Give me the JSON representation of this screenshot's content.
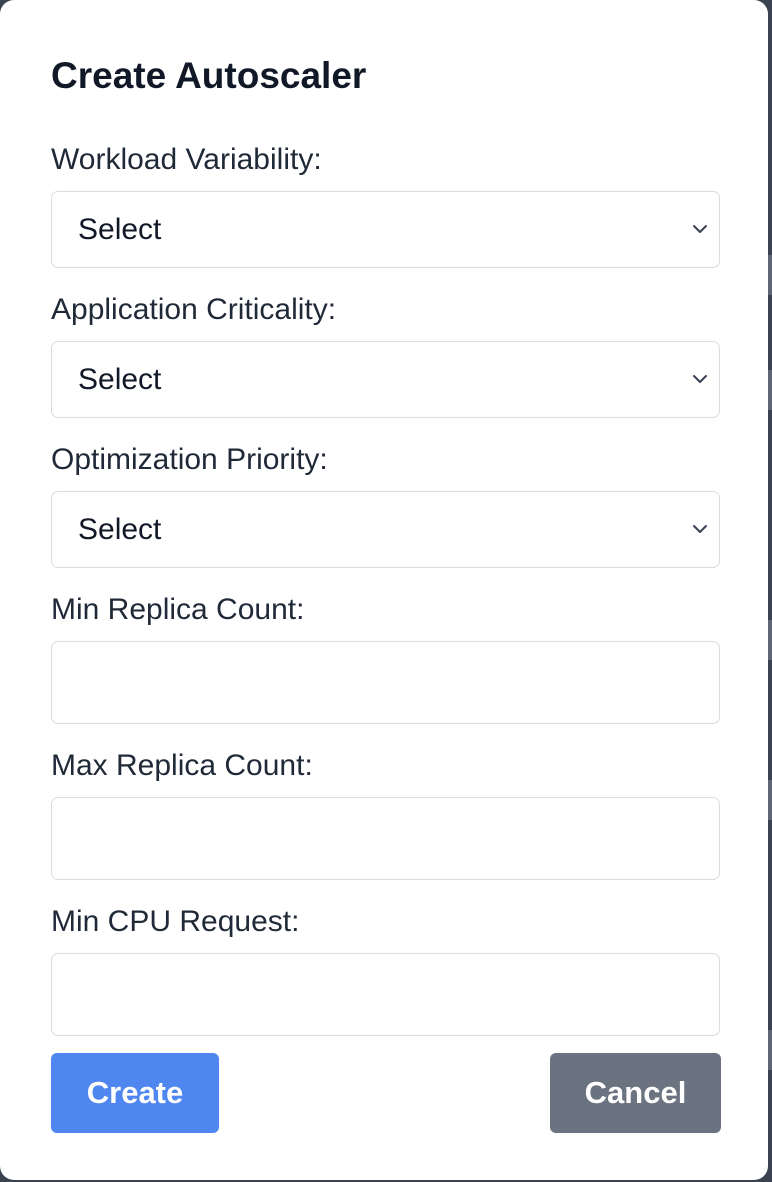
{
  "modal": {
    "title": "Create Autoscaler",
    "fields": {
      "workload_variability": {
        "label": "Workload Variability:",
        "value": "Select"
      },
      "application_criticality": {
        "label": "Application Criticality:",
        "value": "Select"
      },
      "optimization_priority": {
        "label": "Optimization Priority:",
        "value": "Select"
      },
      "min_replica_count": {
        "label": "Min Replica Count:",
        "value": ""
      },
      "max_replica_count": {
        "label": "Max Replica Count:",
        "value": ""
      },
      "min_cpu_request": {
        "label": "Min CPU Request:",
        "value": ""
      }
    },
    "buttons": {
      "create_label": "Create",
      "cancel_label": "Cancel"
    }
  },
  "colors": {
    "primary": "#5086ef",
    "secondary": "#6b7280",
    "title_text": "#111827"
  },
  "icons": {
    "dropdown": "chevron-down-icon"
  }
}
